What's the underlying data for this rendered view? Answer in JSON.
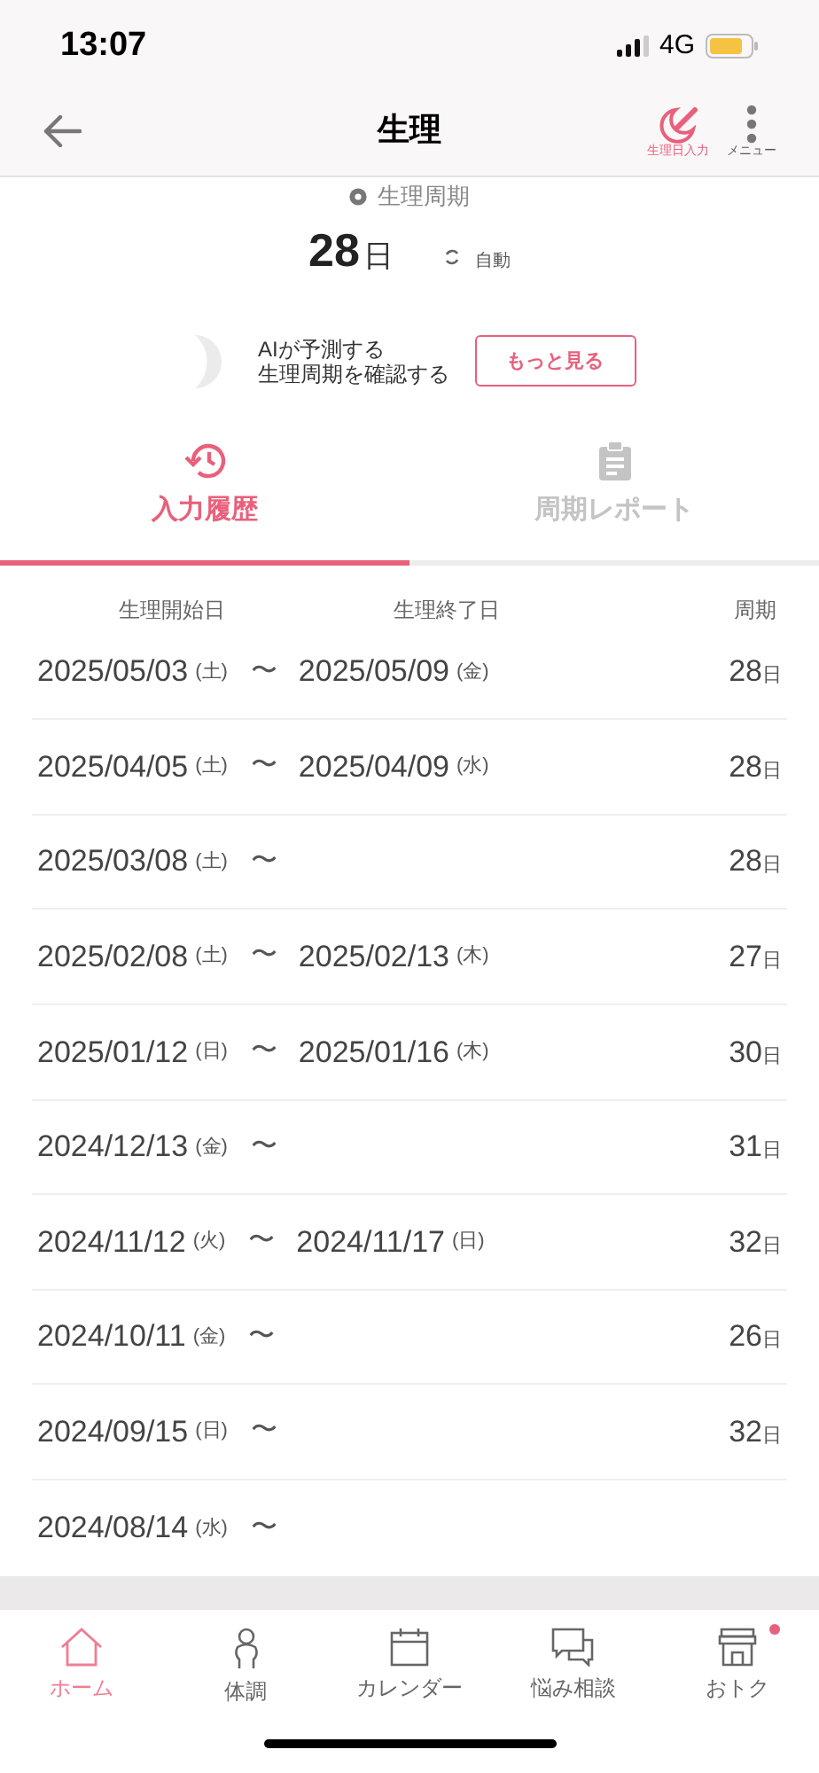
{
  "status_bar": {
    "time": "13:07",
    "network": "4G"
  },
  "header": {
    "title": "生理",
    "actions": [
      {
        "kind": "period-entry",
        "label": "生理日入力"
      },
      {
        "kind": "menu",
        "label": "メニュー"
      }
    ]
  },
  "cycle": {
    "label": "生理周期",
    "value": "28",
    "unit": "日",
    "mode": "自動"
  },
  "ai_banner": {
    "lines": [
      "AIが予測する",
      "生理周期を確認する"
    ],
    "button": "もっと見る"
  },
  "tabs": [
    {
      "kind": "history",
      "label": "入力履歴",
      "selected": true
    },
    {
      "kind": "report",
      "label": "周期レポート",
      "selected": false
    }
  ],
  "table": {
    "columns": [
      "生理開始日",
      "生理終了日",
      "周期"
    ],
    "rows": [
      {
        "start": "2025/05/03",
        "start_day": "(土)",
        "sep": "〜",
        "end": "2025/05/09",
        "end_day": "(金)",
        "cycle": "28",
        "unit": "日"
      },
      {
        "start": "2025/04/05",
        "start_day": "(土)",
        "sep": "〜",
        "end": "2025/04/09",
        "end_day": "(水)",
        "cycle": "28",
        "unit": "日"
      },
      {
        "start": "2025/03/08",
        "start_day": "(土)",
        "sep": "〜",
        "cycle": "28",
        "unit": "日"
      },
      {
        "start": "2025/02/08",
        "start_day": "(土)",
        "sep": "〜",
        "end": "2025/02/13",
        "end_day": "(木)",
        "cycle": "27",
        "unit": "日"
      },
      {
        "start": "2025/01/12",
        "start_day": "(日)",
        "sep": "〜",
        "end": "2025/01/16",
        "end_day": "(木)",
        "cycle": "30",
        "unit": "日"
      },
      {
        "start": "2024/12/13",
        "start_day": "(金)",
        "sep": "〜",
        "cycle": "31",
        "unit": "日"
      },
      {
        "start": "2024/11/12",
        "start_day": "(火)",
        "sep": "〜",
        "end": "2024/11/17",
        "end_day": "(日)",
        "cycle": "32",
        "unit": "日"
      },
      {
        "start": "2024/10/11",
        "start_day": "(金)",
        "sep": "〜",
        "cycle": "26",
        "unit": "日"
      },
      {
        "start": "2024/09/15",
        "start_day": "(日)",
        "sep": "〜",
        "cycle": "32",
        "unit": "日"
      },
      {
        "start": "2024/08/14",
        "start_day": "(水)",
        "sep": "〜"
      }
    ]
  },
  "bottom_nav": [
    {
      "kind": "home",
      "label": "ホーム",
      "selected": true,
      "badge": false
    },
    {
      "kind": "body",
      "label": "体調",
      "selected": false,
      "badge": false
    },
    {
      "kind": "calendar",
      "label": "カレンダー",
      "selected": false,
      "badge": false
    },
    {
      "kind": "chat",
      "label": "悩み相談",
      "selected": false,
      "badge": false
    },
    {
      "kind": "shop",
      "label": "おトク",
      "selected": false,
      "badge": true
    }
  ]
}
